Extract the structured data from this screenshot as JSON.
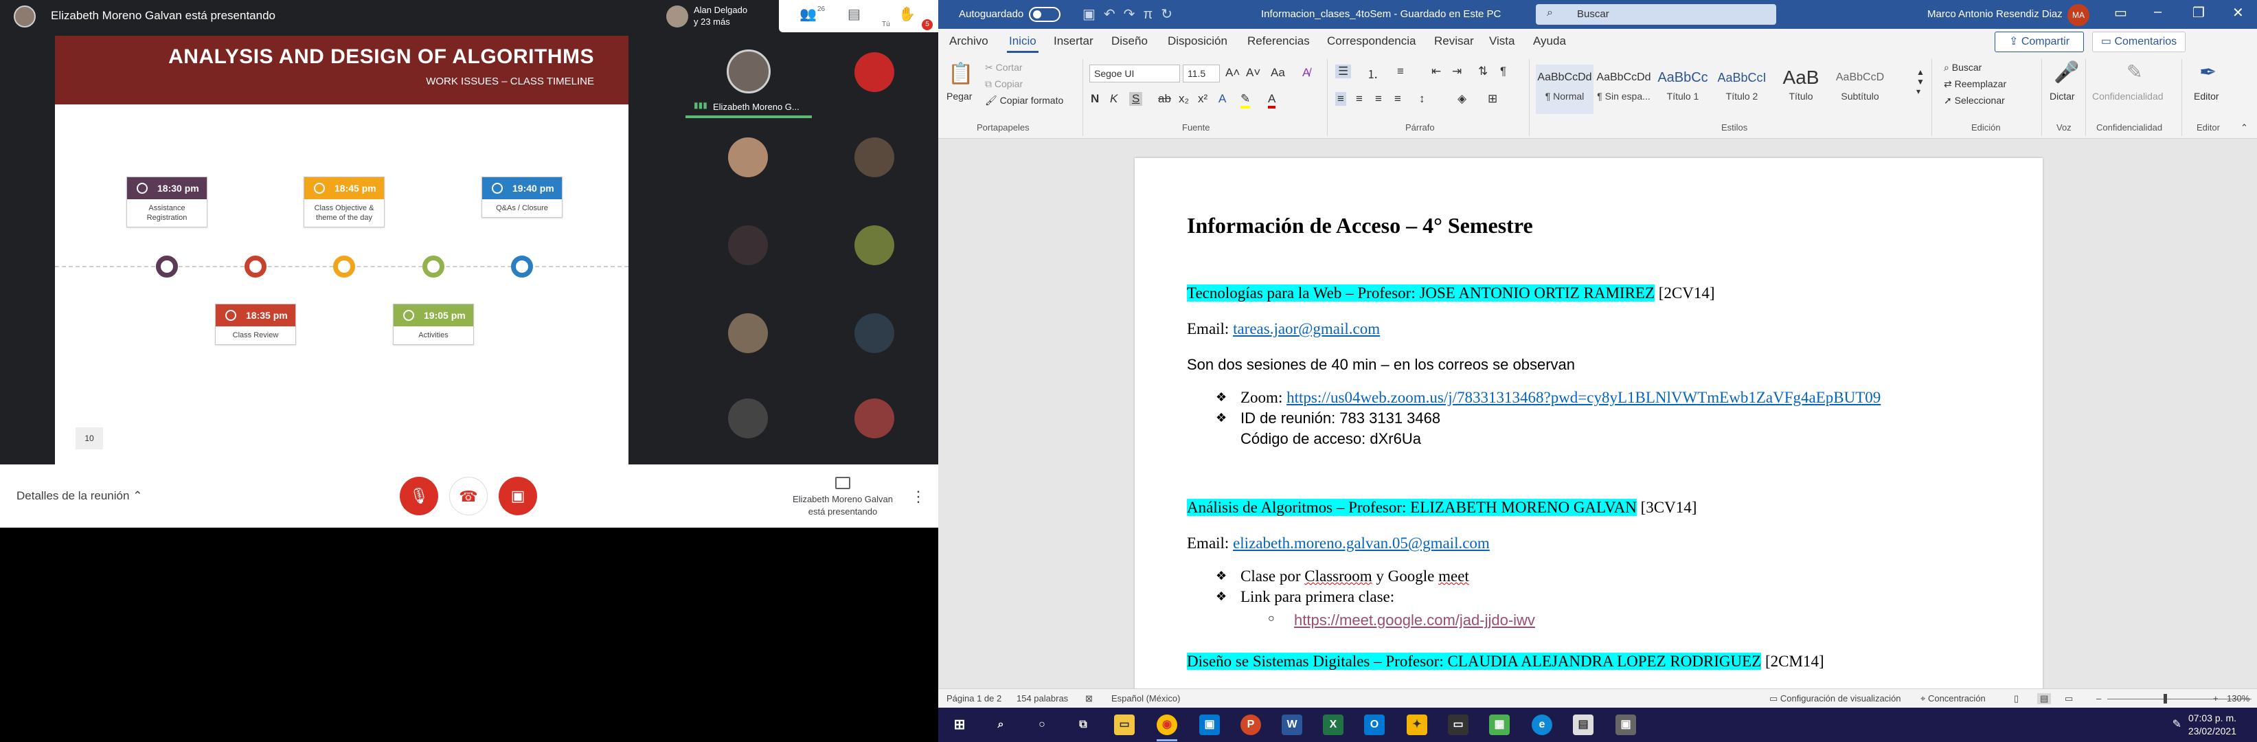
{
  "meet": {
    "presenting_title": "Elizabeth Moreno Galvan está presentando",
    "top_user_line1": "Alan Delgado",
    "top_user_line2": "y 23 más",
    "participants_count": "26",
    "you_label": "Tú",
    "notification_badge": "5",
    "slide": {
      "title": "ANALYSIS AND DESIGN OF ALGORITHMS",
      "subtitle": "WORK ISSUES – CLASS TIMELINE",
      "page_number": "10",
      "events": [
        {
          "time": "18:30 pm",
          "label": "Assistance Registration",
          "color": "#5b3a56"
        },
        {
          "time": "18:35 pm",
          "label": "Class Review",
          "color": "#c8412d"
        },
        {
          "time": "18:45 pm",
          "label": "Class Objective & theme of the day",
          "color": "#f3a51a"
        },
        {
          "time": "19:05 pm",
          "label": "Activities",
          "color": "#92b24b"
        },
        {
          "time": "19:40 pm",
          "label": "Q&As / Closure",
          "color": "#2a7fc4"
        }
      ]
    },
    "tile_name": "Elizabeth Moreno G...",
    "details_label": "Detalles de la reunión",
    "presenting_bottom_line1": "Elizabeth Moreno Galvan",
    "presenting_bottom_line2": "está presentando"
  },
  "word": {
    "autosave": "Autoguardado",
    "doc_title": "Informacion_clases_4toSem  -  Guardado en Este PC",
    "search_placeholder": "Buscar",
    "user_name": "Marco Antonio Resendiz Diaz",
    "user_initials": "MA",
    "tabs": [
      "Archivo",
      "Inicio",
      "Insertar",
      "Diseño",
      "Disposición",
      "Referencias",
      "Correspondencia",
      "Revisar",
      "Vista",
      "Ayuda"
    ],
    "share": "Compartir",
    "comments": "Comentarios",
    "clipboard": {
      "paste": "Pegar",
      "cut": "Cortar",
      "copy": "Copiar",
      "format_painter": "Copiar formato",
      "group": "Portapapeles"
    },
    "font": {
      "name": "Segoe UI",
      "size": "11.5",
      "group": "Fuente"
    },
    "paragraph_group": "Párrafo",
    "styles": [
      {
        "preview": "AaBbCcDd",
        "name": "¶ Normal"
      },
      {
        "preview": "AaBbCcDd",
        "name": "¶ Sin espa..."
      },
      {
        "preview": "AaBbCc",
        "name": "Título 1"
      },
      {
        "preview": "AaBbCcI",
        "name": "Título 2"
      },
      {
        "preview": "AaB",
        "name": "Título"
      },
      {
        "preview": "AaBbCcD",
        "name": "Subtítulo"
      }
    ],
    "styles_group": "Estilos",
    "editing": {
      "find": "Buscar",
      "replace": "Reemplazar",
      "select": "Seleccionar",
      "group": "Edición"
    },
    "voice": {
      "dictate": "Dictar",
      "group": "Voz"
    },
    "sensitivity": {
      "label": "Confidencialidad",
      "group": "Confidencialidad"
    },
    "editor": {
      "label": "Editor",
      "group": "Editor"
    },
    "document": {
      "heading": "Información de Acceso – 4° Semestre",
      "s1_title": "Tecnologías para la Web – Profesor: JOSE ANTONIO ORTIZ RAMIREZ",
      "s1_group": " [2CV14]",
      "s1_email_label": "Email: ",
      "s1_email": "tareas.jaor@gmail.com",
      "s1_note": "Son dos sesiones de 40 min – en los correos se observan",
      "s1_zoom_label": "Zoom: ",
      "s1_zoom_link": "https://us04web.zoom.us/j/78331313468?pwd=cy8yL1BLNlVWTmEwb1ZaVFg4aEpBUT09",
      "s1_meeting_id": "ID de reunión: 783 3131 3468",
      "s1_code": "Código de acceso: dXr6Ua",
      "s2_title": "Análisis de Algoritmos – Profesor: ELIZABETH MORENO GALVAN",
      "s2_group": " [3CV14]",
      "s2_email_label": "Email: ",
      "s2_email": "elizabeth.moreno.galvan.05@gmail.com",
      "s2_b1_pre": "Clase por ",
      "s2_b1_classroom": "Classroom",
      "s2_b1_mid": " y Google ",
      "s2_b1_meet": "meet",
      "s2_b2": "Link para primera clase:",
      "s2_link": "https://meet.google.com/jad-jjdo-iwv",
      "s3_title": "Diseño se Sistemas Digitales – Profesor: CLAUDIA ALEJANDRA LOPEZ RODRIGUEZ",
      "s3_group": " [2CM14]"
    },
    "status": {
      "page": "Página 1 de 2",
      "words": "154 palabras",
      "lang": "Español (México)",
      "display": "Configuración de visualización",
      "focus": "Concentración",
      "zoom": "130%"
    }
  },
  "taskbar": {
    "time": "07:03 p. m.",
    "date": "23/02/2021"
  }
}
